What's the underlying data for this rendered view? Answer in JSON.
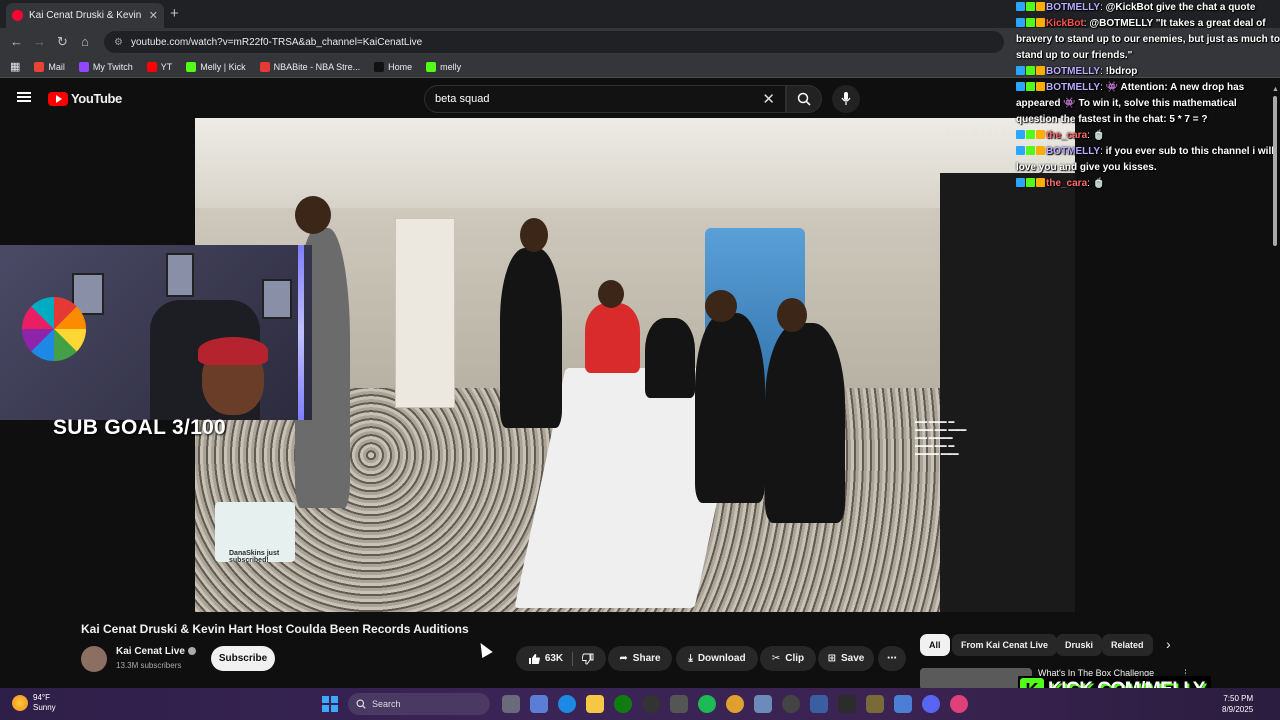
{
  "browser": {
    "tab_title": "Kai Cenat Druski & Kevin H",
    "close_glyph": "✕",
    "new_tab_glyph": "+",
    "url": "youtube.com/watch?v=mR22f0-TRSA&ab_channel=KaiCenatLive",
    "bookmarks": [
      {
        "label": "Mail",
        "color": "#ea4335"
      },
      {
        "label": "My Twitch",
        "color": "#9146ff"
      },
      {
        "label": "YT",
        "color": "#ff0000"
      },
      {
        "label": "Melly | Kick",
        "color": "#53fc18"
      },
      {
        "label": "NBABite - NBA Stre...",
        "color": "#e53935"
      },
      {
        "label": "Home",
        "color": "#111111"
      },
      {
        "label": "melly",
        "color": "#53fc18"
      }
    ]
  },
  "youtube": {
    "logo_text": "YouTube",
    "search_value": "beta squad",
    "clear_glyph": "✕"
  },
  "video": {
    "counter": "151371/152000",
    "sub_goal": "SUB GOAL 3/100",
    "sub_alert": "DanaSkins just subscribed!"
  },
  "chat": {
    "lines": [
      {
        "user": "BOTMELLY",
        "user_color": "#b9a9ff",
        "msg": "@KickBot give the chat a quote"
      },
      {
        "user": "KickBot",
        "user_color": "#ff4f4f",
        "msg": "@BOTMELLY \"It takes a great deal of bravery to stand up to our enemies, but just as much to stand up to our friends.\""
      },
      {
        "user": "BOTMELLY",
        "user_color": "#b9a9ff",
        "msg": "!bdrop"
      },
      {
        "user": "BOTMELLY",
        "user_color": "#b9a9ff",
        "msg": "👾 Attention: A new drop has appeared 👾 To win it, solve this mathematical question the fastest in the chat: 5 * 7 = ?"
      },
      {
        "user": "the_cara",
        "user_color": "#ff6b6b",
        "msg": "🍵"
      },
      {
        "user": "BOTMELLY",
        "user_color": "#b9a9ff",
        "msg": "if you ever sub to this channel i will love you and give you kisses."
      },
      {
        "user": "the_cara",
        "user_color": "#ff6b6b",
        "msg": "🍵"
      }
    ]
  },
  "meta": {
    "title": "Kai Cenat Druski & Kevin Hart Host Coulda Been Records Auditions",
    "channel": "Kai Cenat Live",
    "subscribers": "13.3M subscribers",
    "subscribe_label": "Subscribe",
    "likes": "63K",
    "share_label": "Share",
    "download_label": "Download",
    "clip_label": "Clip",
    "save_label": "Save",
    "more_glyph": "⋯"
  },
  "chips": [
    {
      "label": "All",
      "active": true
    },
    {
      "label": "From Kai Cenat Live",
      "active": false
    },
    {
      "label": "Druski",
      "active": false
    },
    {
      "label": "Related",
      "active": false
    }
  ],
  "recommendation": {
    "title": "What's In The Box Challenge",
    "more_glyph": "⋮"
  },
  "kick": {
    "badge": "K",
    "text": "KICK.COM/MELLY"
  },
  "taskbar": {
    "temp": "94°F",
    "condition": "Sunny",
    "search_label": "Search",
    "time": "7:50 PM",
    "date": "8/9/2025"
  }
}
